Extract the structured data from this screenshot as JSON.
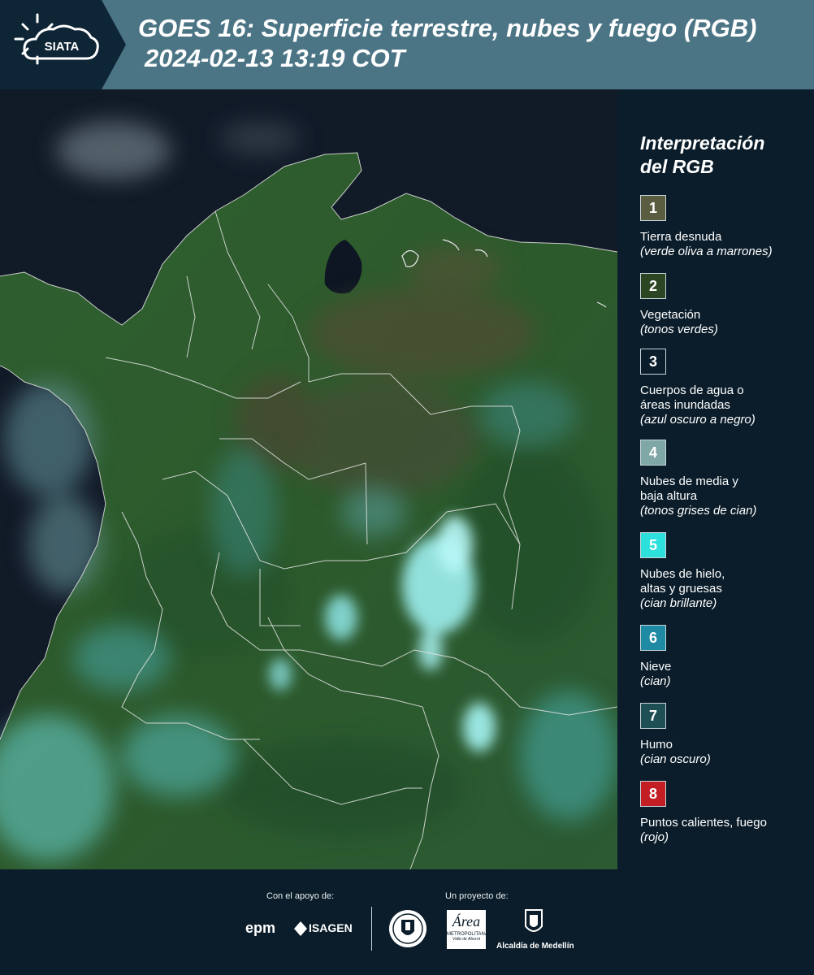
{
  "header": {
    "logo_text": "SIATA",
    "title_line1": "GOES 16: Superficie terrestre, nubes y fuego (RGB)",
    "title_line2": "2024-02-13 13:19 COT"
  },
  "legend": {
    "title_line1": "Interpretación",
    "title_line2": "del RGB",
    "items": [
      {
        "num": "1",
        "color": "#5a5d3f",
        "line1": "Tierra desnuda",
        "line2": "",
        "note": "(verde oliva a marrones)"
      },
      {
        "num": "2",
        "color": "#2c4523",
        "line1": "Vegetación",
        "line2": "",
        "note": "(tonos verdes)"
      },
      {
        "num": "3",
        "color": "#0b1d2a",
        "line1": "Cuerpos de agua o",
        "line2": "áreas inundadas",
        "note": "(azul oscuro a negro)"
      },
      {
        "num": "4",
        "color": "#7fa7a6",
        "line1": "Nubes de media y",
        "line2": "baja altura",
        "note": "(tonos grises de cian)"
      },
      {
        "num": "5",
        "color": "#2ee0dc",
        "line1": "Nubes de hielo,",
        "line2": "altas y gruesas",
        "note": "(cian brillante)"
      },
      {
        "num": "6",
        "color": "#1e8aa3",
        "line1": "Nieve",
        "line2": "",
        "note": "(cian)"
      },
      {
        "num": "7",
        "color": "#1d4f55",
        "line1": "Humo",
        "line2": "",
        "note": "(cian oscuro)"
      },
      {
        "num": "8",
        "color": "#c41e25",
        "line1": "Puntos calientes, fuego",
        "line2": "",
        "note": "(rojo)"
      }
    ]
  },
  "footer": {
    "support_label": "Con el apoyo de:",
    "project_label": "Un proyecto de:",
    "brand_epm": "epm",
    "brand_isagen": "ISAGEN",
    "brand_area_top": "Área",
    "brand_area_sub": "METROPOLITANA",
    "brand_area_sub2": "Valle de Aburrá",
    "brand_alcaldia": "Alcaldía de Medellín"
  }
}
